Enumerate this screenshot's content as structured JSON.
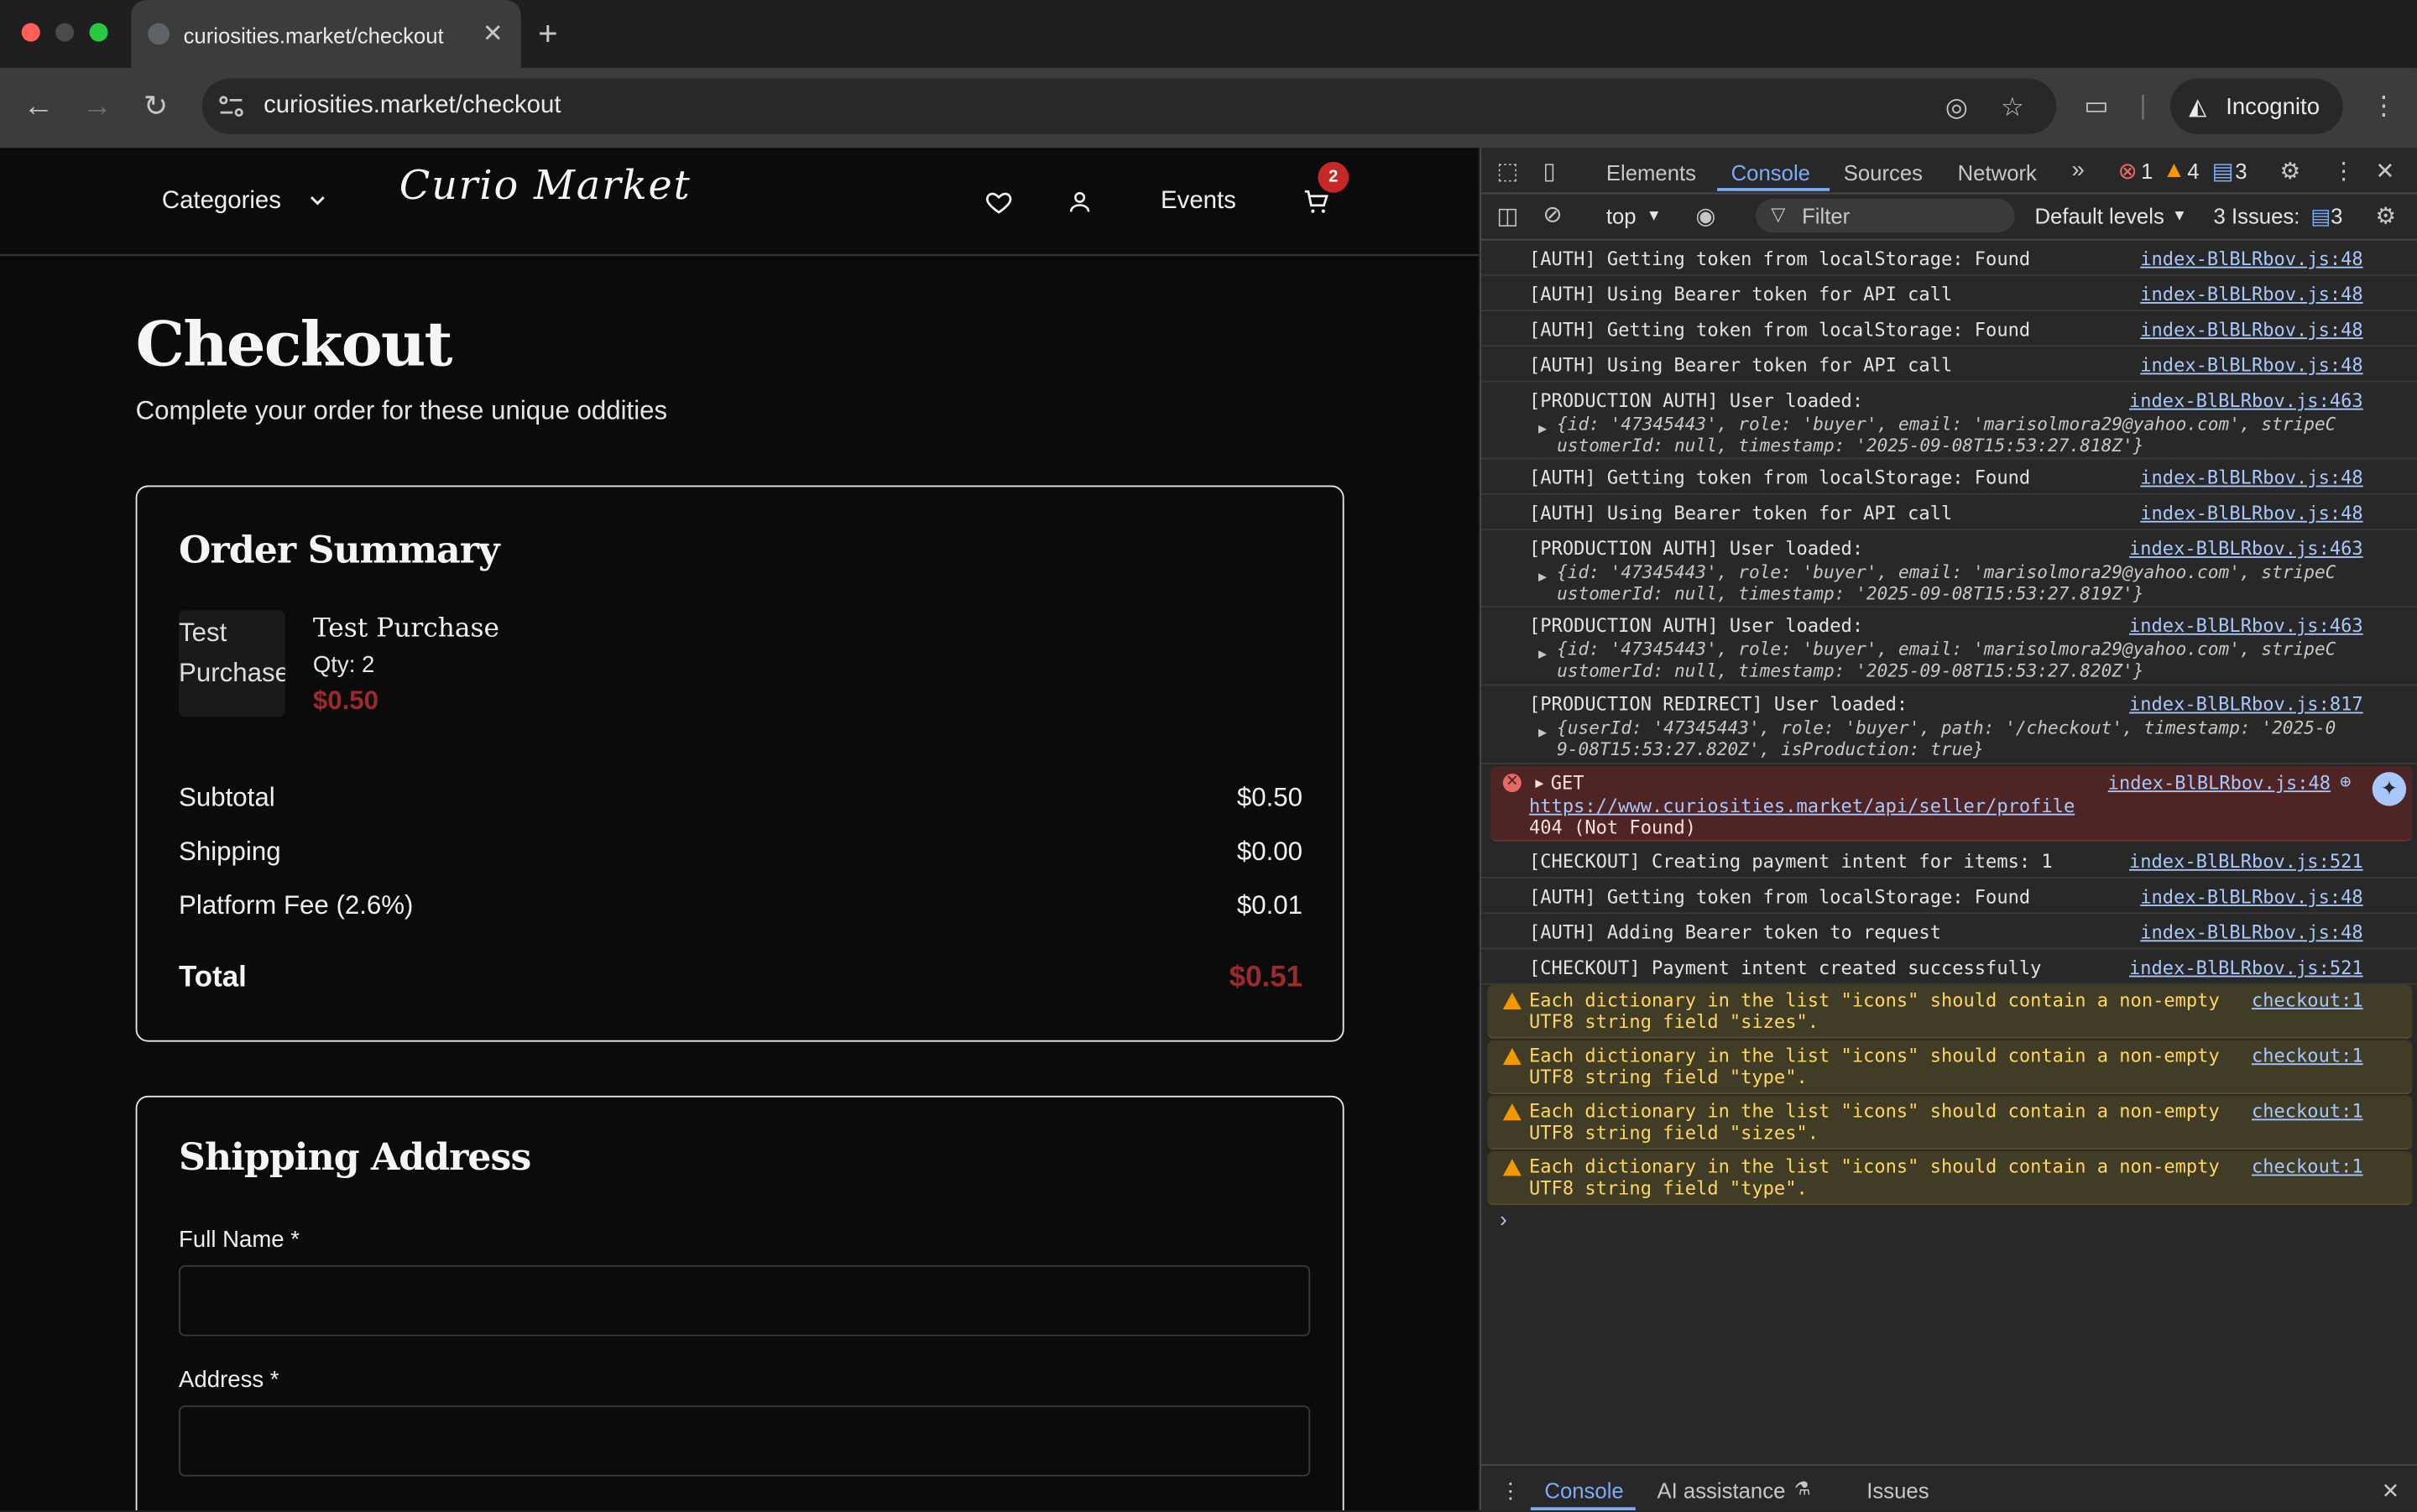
{
  "browser": {
    "tab_title": "curiosities.market/checkout",
    "url": "curiosities.market/checkout",
    "incognito_label": "Incognito"
  },
  "site": {
    "nav": {
      "categories": "Categories",
      "logo": "Curio Market",
      "events": "Events",
      "cart_count": "2"
    },
    "page_title": "Checkout",
    "page_subtitle": "Complete your order for these unique oddities",
    "order_summary": {
      "heading": "Order Summary",
      "item": {
        "image_alt": "Test Purchase",
        "name": "Test Purchase",
        "qty": "Qty: 2",
        "price": "$0.50"
      },
      "rows": [
        {
          "label": "Subtotal",
          "value": "$0.50"
        },
        {
          "label": "Shipping",
          "value": "$0.00"
        },
        {
          "label": "Platform Fee (2.6%)",
          "value": "$0.01"
        }
      ],
      "total_label": "Total",
      "total_value": "$0.51"
    },
    "shipping": {
      "heading": "Shipping Address",
      "fields": [
        {
          "label": "Full Name *",
          "value": ""
        },
        {
          "label": "Address *",
          "value": ""
        }
      ]
    }
  },
  "devtools": {
    "tabs": [
      "Elements",
      "Console",
      "Sources",
      "Network"
    ],
    "active_tab": "Console",
    "counts": {
      "errors": "1",
      "warnings": "4",
      "messages": "3"
    },
    "context": "top",
    "filter_placeholder": "Filter",
    "levels": "Default levels",
    "issues_label": "3 Issues:",
    "issues_count": "3",
    "logs": [
      {
        "type": "log",
        "msg": "[AUTH] Getting token from localStorage: Found",
        "src": "index-BlBLRbov.js:48"
      },
      {
        "type": "log",
        "msg": "[AUTH] Using Bearer token for API call",
        "src": "index-BlBLRbov.js:48"
      },
      {
        "type": "log",
        "msg": "[AUTH] Getting token from localStorage: Found",
        "src": "index-BlBLRbov.js:48"
      },
      {
        "type": "log",
        "msg": "[AUTH] Using Bearer token for API call",
        "src": "index-BlBLRbov.js:48"
      },
      {
        "type": "obj",
        "msg": "[PRODUCTION AUTH] User loaded:",
        "src": "index-BlBLRbov.js:463",
        "obj1": "{id: '47345443', role: 'buyer', email: 'marisolmora29@yahoo.com', stripeC",
        "obj2": "ustomerId: null, timestamp: '2025-09-08T15:53:27.818Z'}"
      },
      {
        "type": "log",
        "msg": "[AUTH] Getting token from localStorage: Found",
        "src": "index-BlBLRbov.js:48"
      },
      {
        "type": "log",
        "msg": "[AUTH] Using Bearer token for API call",
        "src": "index-BlBLRbov.js:48"
      },
      {
        "type": "obj",
        "msg": "[PRODUCTION AUTH] User loaded:",
        "src": "index-BlBLRbov.js:463",
        "obj1": "{id: '47345443', role: 'buyer', email: 'marisolmora29@yahoo.com', stripeC",
        "obj2": "ustomerId: null, timestamp: '2025-09-08T15:53:27.819Z'}"
      },
      {
        "type": "obj",
        "msg": "[PRODUCTION AUTH] User loaded:",
        "src": "index-BlBLRbov.js:463",
        "obj1": "{id: '47345443', role: 'buyer', email: 'marisolmora29@yahoo.com', stripeC",
        "obj2": "ustomerId: null, timestamp: '2025-09-08T15:53:27.820Z'}"
      },
      {
        "type": "obj",
        "msg": "[PRODUCTION REDIRECT] User loaded:",
        "src": "index-BlBLRbov.js:817",
        "obj1": "{userId: '47345443', role: 'buyer', path: '/checkout', timestamp: '2025-0",
        "obj2": "9-08T15:53:27.820Z', isProduction: true}"
      },
      {
        "type": "error",
        "msg": "GET",
        "src": "index-BlBLRbov.js:48",
        "line2": "https://www.curiosities.market/api/seller/profile",
        "line3": "404 (Not Found)"
      },
      {
        "type": "log",
        "msg": "[CHECKOUT] Creating payment intent for items: 1",
        "src": "index-BlBLRbov.js:521"
      },
      {
        "type": "log",
        "msg": "[AUTH] Getting token from localStorage: Found",
        "src": "index-BlBLRbov.js:48"
      },
      {
        "type": "log",
        "msg": "[AUTH] Adding Bearer token to request",
        "src": "index-BlBLRbov.js:48"
      },
      {
        "type": "log",
        "msg": "[CHECKOUT] Payment intent created successfully",
        "src": "index-BlBLRbov.js:521"
      },
      {
        "type": "warn",
        "msg": "Each dictionary in the list \"icons\" should contain a non-empty",
        "line2": "UTF8 string field \"sizes\".",
        "src": "checkout:1"
      },
      {
        "type": "warn",
        "msg": "Each dictionary in the list \"icons\" should contain a non-empty",
        "line2": "UTF8 string field \"type\".",
        "src": "checkout:1"
      },
      {
        "type": "warn",
        "msg": "Each dictionary in the list \"icons\" should contain a non-empty",
        "line2": "UTF8 string field \"sizes\".",
        "src": "checkout:1"
      },
      {
        "type": "warn",
        "msg": "Each dictionary in the list \"icons\" should contain a non-empty",
        "line2": "UTF8 string field \"type\".",
        "src": "checkout:1"
      }
    ],
    "drawer_tabs": [
      "Console",
      "AI assistance",
      "Issues"
    ]
  },
  "colors": {
    "accent_price": "#9c2a2a",
    "devtools_blue": "#7cacf8",
    "badge_red": "#c62828"
  }
}
